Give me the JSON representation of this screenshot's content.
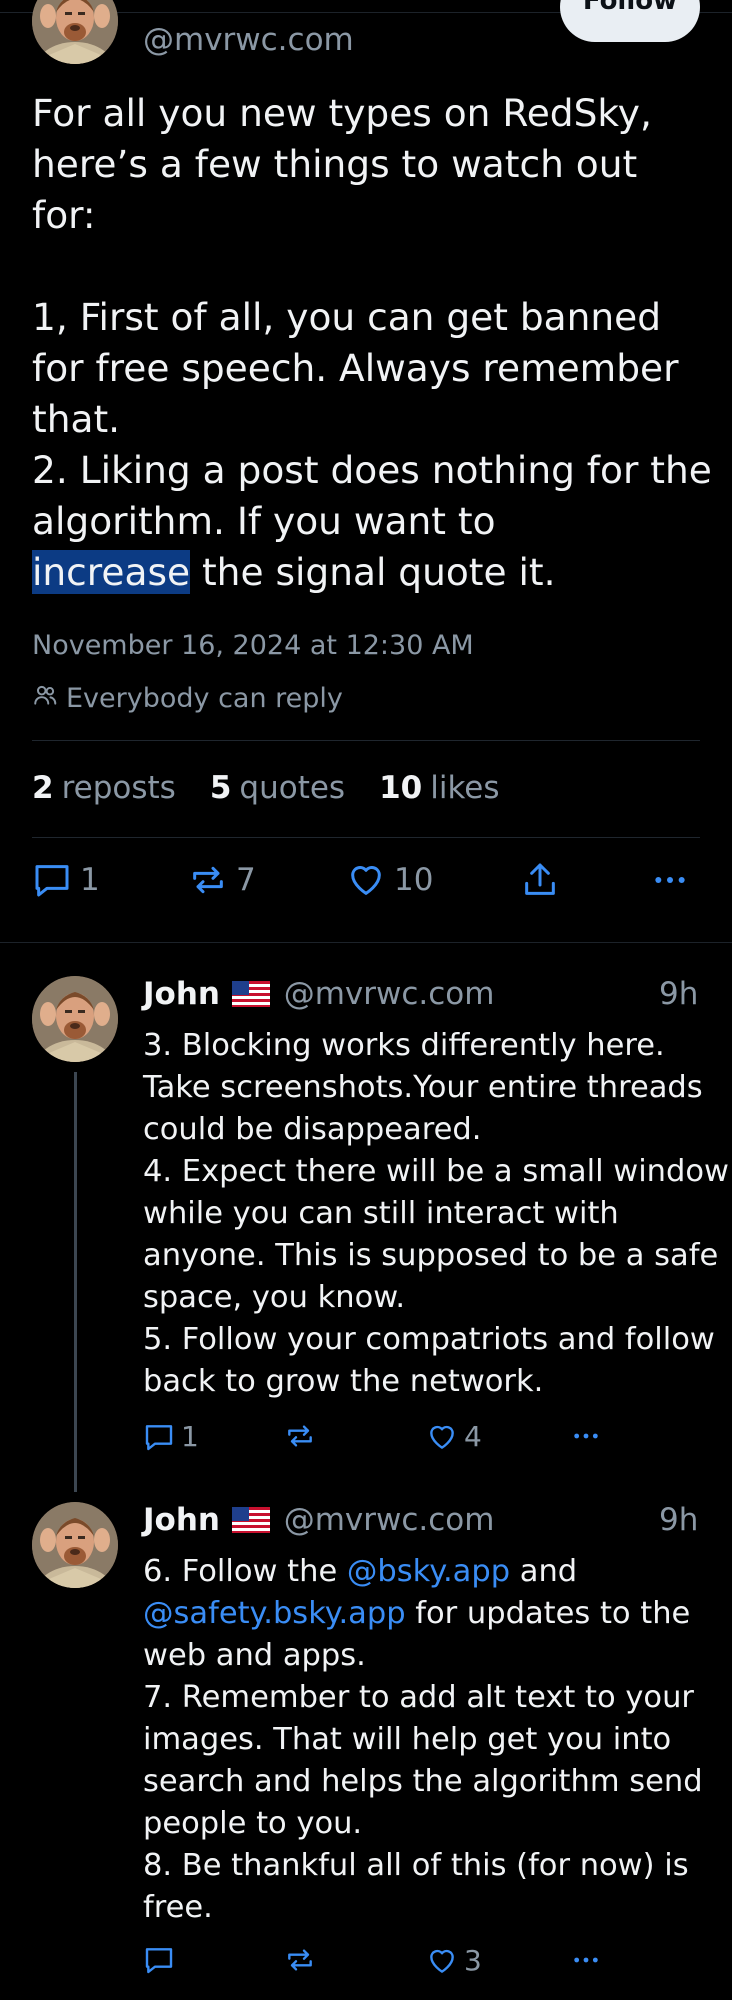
{
  "post": {
    "handle": "@mvrwc.com",
    "follow_label": "Follow",
    "paragraphs": [
      "For all you new types on RedSky, here’s a few things to watch out for:",
      "1, First of all, you can get banned for free speech. Always remember that.",
      "2. Liking a post does nothing for the algorithm. If you want to"
    ],
    "highlight_word": "increase",
    "tail": " the signal quote it.",
    "date": "November 16, 2024 at 12:30 AM",
    "reply_setting": "Everybody can reply",
    "stats": {
      "reposts_count": "2",
      "reposts_label": "reposts",
      "quotes_count": "5",
      "quotes_label": "quotes",
      "likes_count": "10",
      "likes_label": "likes"
    },
    "actions": {
      "replies": "1",
      "reposts": "7",
      "likes": "10"
    }
  },
  "replies": [
    {
      "name": "John",
      "handle": "@mvrwc.com",
      "time": "9h",
      "lines": [
        "3. Blocking works differently here. Take screenshots.Your entire threads could be disappeared.",
        "4. Expect there will be a small window while you can still interact with anyone. This is supposed to be a safe space, you know.",
        "5. Follow your compatriots and follow back to grow the network."
      ],
      "replies": "1",
      "likes": "4"
    },
    {
      "name": "John",
      "handle": "@mvrwc.com",
      "time": "9h",
      "line1_pre": "6. Follow the ",
      "mention1": "@bsky.app",
      "line1_mid": " and",
      "mention2": "@safety.bsky.app",
      "line1_post": " for updates to the web and apps.",
      "lines": [
        "7. Remember to add alt text to your images. That will help get you into search and helps the algorithm send people to you.",
        "8. Be thankful all of this (for now) is free."
      ],
      "likes": "3"
    }
  ]
}
